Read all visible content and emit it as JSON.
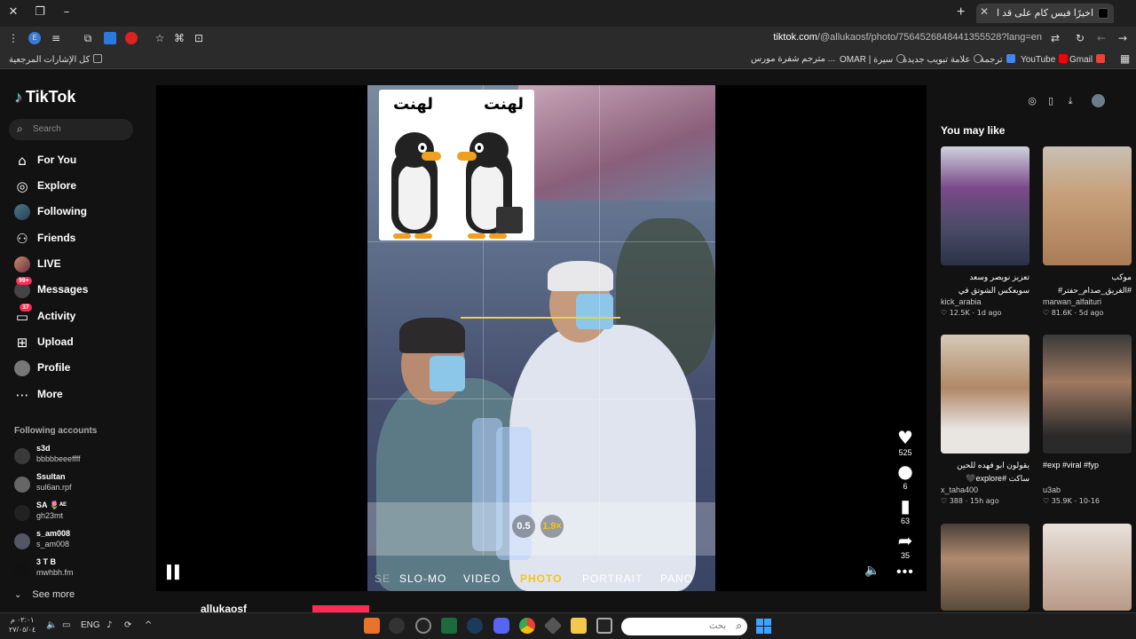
{
  "browser": {
    "tab_title": "اخيرًا فيس كام على قد الحال",
    "url_host": "tiktok.com",
    "url_path": "/@allukaosf/photo/7564526848441355528?lang=en",
    "bookmarks": [
      {
        "label": "كل الإشارات المرجعية",
        "color": "#888"
      },
      {
        "label": "Gmail",
        "color": "#ea4335"
      },
      {
        "label": "YouTube",
        "color": "#ff0000"
      },
      {
        "label": "ترجمة",
        "color": "#4285f4"
      },
      {
        "label": "علامة تبويب جديدة",
        "color": "#888"
      },
      {
        "label": "OMAR | سيرة",
        "color": "#888"
      },
      {
        "label": "مترجم شفرة مورس ...",
        "color": "#888"
      }
    ]
  },
  "sidebar": {
    "logo": "TikTok",
    "search_placeholder": "Search",
    "nav": [
      {
        "label": "For You",
        "icon": "home-icon"
      },
      {
        "label": "Explore",
        "icon": "compass-icon"
      },
      {
        "label": "Following",
        "icon": "avatar-icon"
      },
      {
        "label": "Friends",
        "icon": "friends-icon"
      },
      {
        "label": "LIVE",
        "icon": "live-icon"
      },
      {
        "label": "Messages",
        "icon": "messages-icon",
        "badge": "99+"
      },
      {
        "label": "Activity",
        "icon": "activity-icon",
        "badge": "37"
      },
      {
        "label": "Upload",
        "icon": "upload-icon"
      },
      {
        "label": "Profile",
        "icon": "profile-icon"
      },
      {
        "label": "More",
        "icon": "more-icon"
      }
    ],
    "following_title": "Following accounts",
    "accounts": [
      {
        "name": "s3d",
        "user": "bbbbbeeeffff"
      },
      {
        "name": "Ssultan",
        "user": "sul6an.rpf"
      },
      {
        "name": "SA 🌷ᴬᴱ",
        "user": "gh23mt"
      },
      {
        "name": "s_am008",
        "user": "s_am008"
      },
      {
        "name": "3 T B",
        "user": "mwhbh.fm"
      }
    ],
    "see_more": "See more"
  },
  "player": {
    "meme_text_left": "لهنت",
    "meme_text_right": "لهنت",
    "zoom": [
      "0.5",
      "1.9×"
    ],
    "modes": [
      "SE",
      "SLO-MO",
      "VIDEO",
      "PHOTO",
      "PORTRAIT",
      "PANO"
    ],
    "selected_mode": "PHOTO",
    "likes": "525",
    "comments": "6",
    "saves": "63",
    "shares": "35",
    "author": "allukaosf"
  },
  "you_may_like": {
    "title": "You may like",
    "cards": [
      {
        "caption": "تعزيز نويصر وسعد سويعكس الشوتق في مباراته ضد عيسى",
        "user": "kick_arabia",
        "likes": "12.5K",
        "age": "1d ago",
        "rtl": true
      },
      {
        "caption": "موكب #الغريق_صدام_حفتر# ليبيا# #libyaLY ly",
        "user": "marwan_alfaituri",
        "likes": "81.6K",
        "age": "5d ago",
        "rtl": true
      },
      {
        "caption": "يقولون ابو فهده للحين ساكت #explore🖤☠️اكسبلور",
        "user": "x_taha400",
        "likes": "388",
        "age": "15h ago",
        "rtl": true
      },
      {
        "caption": "#exp #viral #fyp",
        "user": "u3ab",
        "likes": "35.9K",
        "age": "10-16",
        "rtl": false
      },
      {
        "caption": "",
        "user": "",
        "likes": "",
        "age": "",
        "rtl": false
      },
      {
        "caption": "",
        "user": "",
        "likes": "",
        "age": "",
        "rtl": false
      }
    ]
  },
  "taskbar": {
    "time": "٠٢:٠١ م",
    "date": "٢٧/٠٥/٠٤",
    "lang": "ENG",
    "search_placeholder": "بحث"
  }
}
